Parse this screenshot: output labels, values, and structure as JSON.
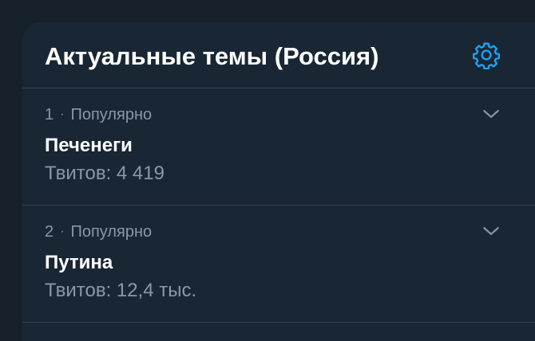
{
  "panel": {
    "title": "Актуальные темы (Россия)",
    "settings_icon": "gear-icon"
  },
  "colors": {
    "page_bg": "#15202b",
    "panel_bg": "#192734",
    "accent": "#1da1f2",
    "text_primary": "#ffffff",
    "text_secondary": "#8899a6",
    "divider": "#38444d"
  },
  "trends": [
    {
      "rank": "1",
      "separator": "·",
      "context": "Популярно",
      "name": "Печенеги",
      "tweet_count": "Твитов: 4 419",
      "menu_icon": "chevron-down-icon"
    },
    {
      "rank": "2",
      "separator": "·",
      "context": "Популярно",
      "name": "Путина",
      "tweet_count": "Твитов: 12,4 тыс.",
      "menu_icon": "chevron-down-icon"
    }
  ]
}
